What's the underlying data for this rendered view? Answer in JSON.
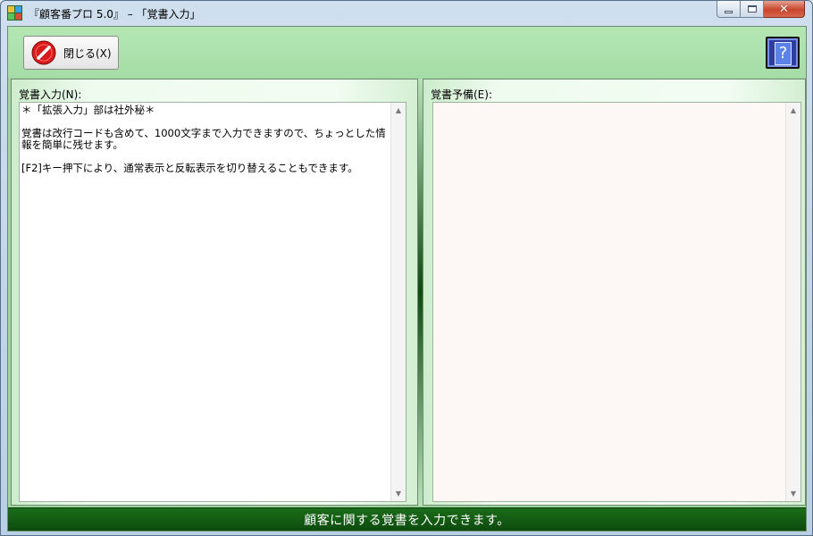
{
  "window": {
    "title": "『顧客番プロ 5.0』 – 「覚書入力」",
    "app_icon": "app-grid-icon",
    "controls": {
      "minimize": "minimize-icon",
      "maximize": "maximize-icon",
      "close": "✕"
    }
  },
  "toolbar": {
    "close_label": "閉じる(X)",
    "close_icon": "no-entry-icon",
    "help_icon": "help-icon",
    "help_glyph": "?"
  },
  "left_panel": {
    "label": "覚書入力(N):",
    "content": "＊「拡張入力」部は社外秘＊\n\n覚書は改行コードも含めて、1000文字まで入力できますので、ちょっとした情報を簡単に残せます。\n\n[F2]キー押下により、通常表示と反転表示を切り替えることもできます。"
  },
  "right_panel": {
    "label": "覚書予備(E):",
    "content": ""
  },
  "scrollbar": {
    "up": "▲",
    "down": "▼"
  },
  "status_bar": {
    "text": "顧客に関する覚書を入力できます。"
  },
  "colors": {
    "panel_bg": "#a6dca6",
    "status_bg": "#0d4a0d",
    "help_bg": "#2f3d9c",
    "close_icon_red": "#d81b1b"
  }
}
